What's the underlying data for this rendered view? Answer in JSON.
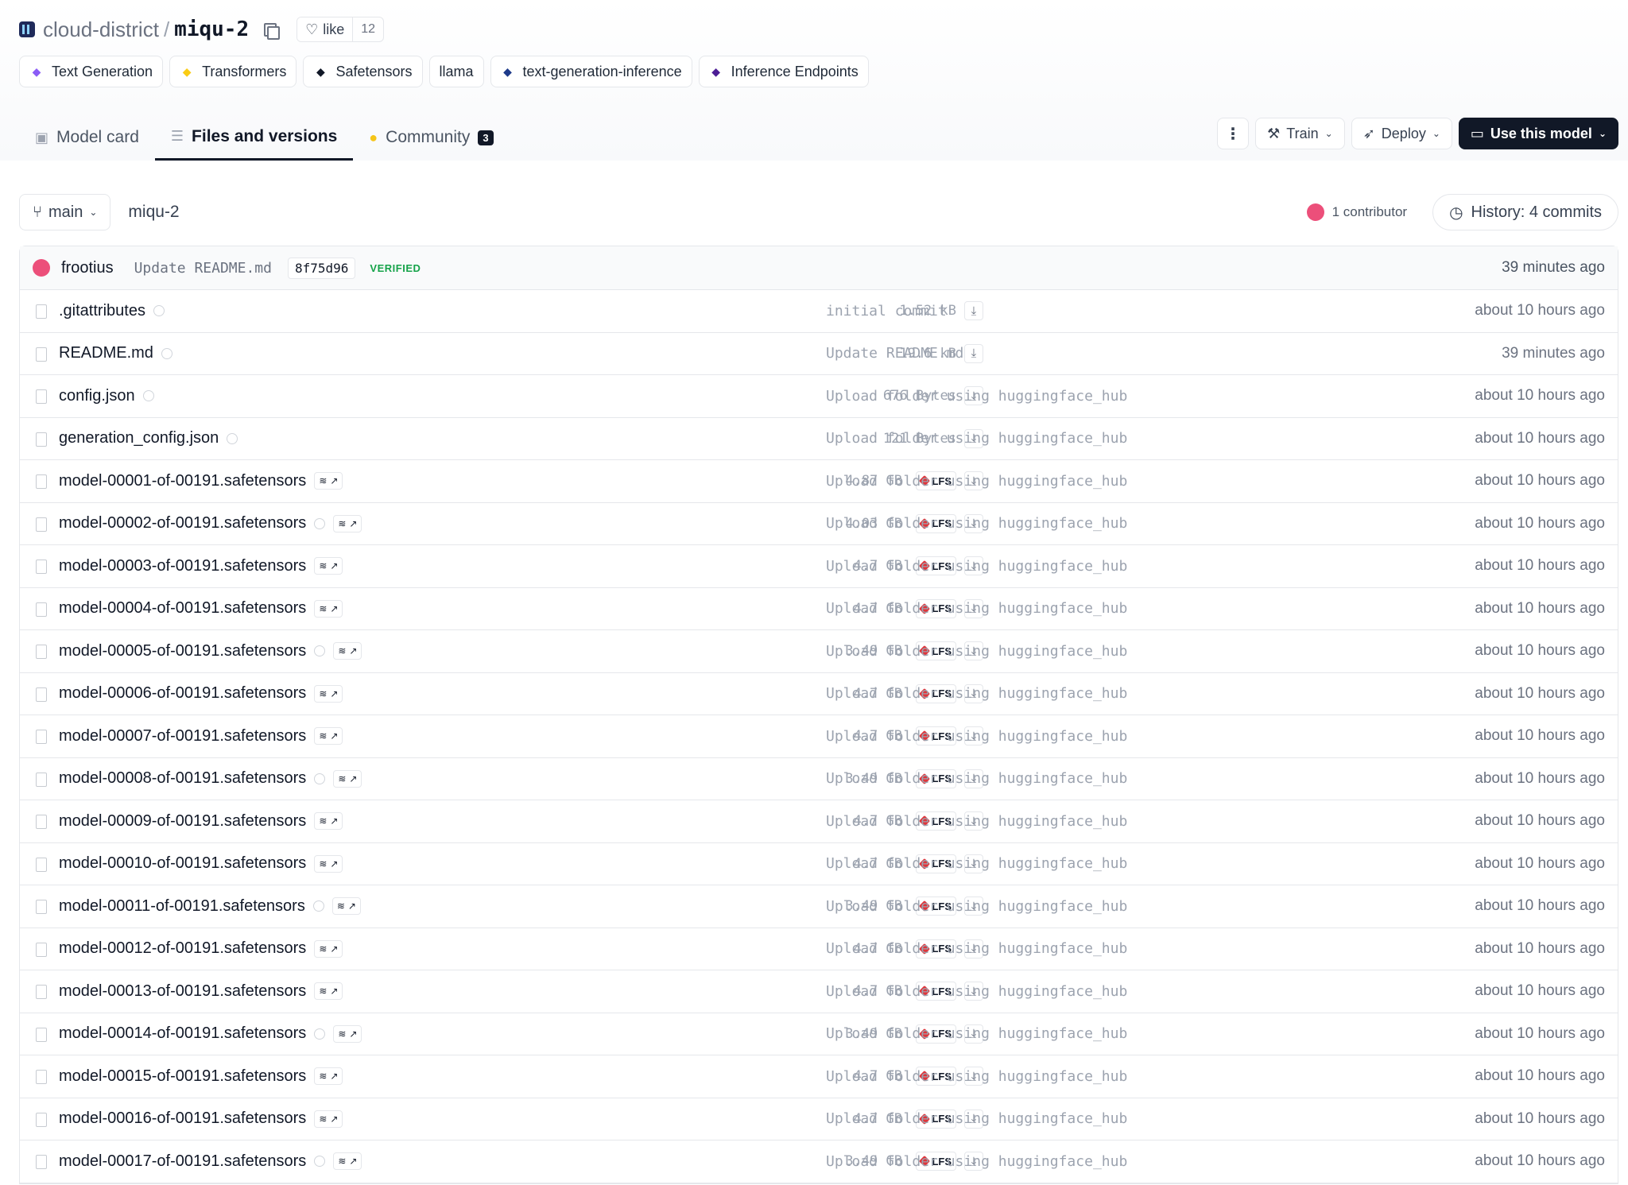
{
  "header": {
    "org": "cloud-district",
    "separator": "/",
    "repo": "miqu-2",
    "like_label": "like",
    "like_count": "12"
  },
  "tags": [
    {
      "label": "Text Generation",
      "icon": "text-generation-icon",
      "color": "#8b5cf6"
    },
    {
      "label": "Transformers",
      "icon": "hugging-face-icon",
      "color": "#facc15"
    },
    {
      "label": "Safetensors",
      "icon": "safetensors-icon",
      "color": "#111827"
    },
    {
      "label": "llama",
      "icon": "",
      "color": ""
    },
    {
      "label": "text-generation-inference",
      "icon": "tgi-icon",
      "color": "#1e3a8a"
    },
    {
      "label": "Inference Endpoints",
      "icon": "inference-endpoints-icon",
      "color": "#4c1d95"
    }
  ],
  "tabs": [
    {
      "label": "Model card",
      "icon": "model-card-icon",
      "active": false
    },
    {
      "label": "Files and versions",
      "icon": "files-icon",
      "active": true
    },
    {
      "label": "Community",
      "icon": "community-icon",
      "active": false,
      "badge": "3"
    }
  ],
  "actions": {
    "train": "Train",
    "deploy": "Deploy",
    "use_model": "Use this model"
  },
  "branch": {
    "name": "main",
    "path": "miqu-2",
    "contributors": "1 contributor",
    "history": "History: 4 commits"
  },
  "last_commit": {
    "author": "frootius",
    "message": "Update README.md",
    "hash": "8f75d96",
    "verified": "VERIFIED",
    "time": "39 minutes ago"
  },
  "files": [
    {
      "name": ".gitattributes",
      "size": "1.52 kB",
      "lfs": false,
      "st": false,
      "st_check": false,
      "message": "initial commit",
      "time": "about 10 hours ago"
    },
    {
      "name": "README.md",
      "size": "19.6 kB",
      "lfs": false,
      "st": false,
      "st_check": false,
      "message": "Update README.md",
      "time": "39 minutes ago"
    },
    {
      "name": "config.json",
      "size": "676 Bytes",
      "lfs": false,
      "st": false,
      "st_check": false,
      "message": "Upload folder using huggingface_hub",
      "time": "about 10 hours ago"
    },
    {
      "name": "generation_config.json",
      "size": "121 Bytes",
      "lfs": false,
      "st": false,
      "st_check": false,
      "message": "Upload folder using huggingface_hub",
      "time": "about 10 hours ago"
    },
    {
      "name": "model-00001-of-00191.safetensors",
      "size": "4.87 GB",
      "lfs": true,
      "st": true,
      "st_check": false,
      "message": "Upload folder using huggingface_hub",
      "time": "about 10 hours ago"
    },
    {
      "name": "model-00002-of-00191.safetensors",
      "size": "4.03 GB",
      "lfs": true,
      "st": true,
      "st_check": true,
      "message": "Upload folder using huggingface_hub",
      "time": "about 10 hours ago"
    },
    {
      "name": "model-00003-of-00191.safetensors",
      "size": "4.7 GB",
      "lfs": true,
      "st": true,
      "st_check": false,
      "message": "Upload folder using huggingface_hub",
      "time": "about 10 hours ago"
    },
    {
      "name": "model-00004-of-00191.safetensors",
      "size": "4.7 GB",
      "lfs": true,
      "st": true,
      "st_check": false,
      "message": "Upload folder using huggingface_hub",
      "time": "about 10 hours ago"
    },
    {
      "name": "model-00005-of-00191.safetensors",
      "size": "3.49 GB",
      "lfs": true,
      "st": true,
      "st_check": true,
      "message": "Upload folder using huggingface_hub",
      "time": "about 10 hours ago"
    },
    {
      "name": "model-00006-of-00191.safetensors",
      "size": "4.7 GB",
      "lfs": true,
      "st": true,
      "st_check": false,
      "message": "Upload folder using huggingface_hub",
      "time": "about 10 hours ago"
    },
    {
      "name": "model-00007-of-00191.safetensors",
      "size": "4.7 GB",
      "lfs": true,
      "st": true,
      "st_check": false,
      "message": "Upload folder using huggingface_hub",
      "time": "about 10 hours ago"
    },
    {
      "name": "model-00008-of-00191.safetensors",
      "size": "3.49 GB",
      "lfs": true,
      "st": true,
      "st_check": true,
      "message": "Upload folder using huggingface_hub",
      "time": "about 10 hours ago"
    },
    {
      "name": "model-00009-of-00191.safetensors",
      "size": "4.7 GB",
      "lfs": true,
      "st": true,
      "st_check": false,
      "message": "Upload folder using huggingface_hub",
      "time": "about 10 hours ago"
    },
    {
      "name": "model-00010-of-00191.safetensors",
      "size": "4.7 GB",
      "lfs": true,
      "st": true,
      "st_check": false,
      "message": "Upload folder using huggingface_hub",
      "time": "about 10 hours ago"
    },
    {
      "name": "model-00011-of-00191.safetensors",
      "size": "3.49 GB",
      "lfs": true,
      "st": true,
      "st_check": true,
      "message": "Upload folder using huggingface_hub",
      "time": "about 10 hours ago"
    },
    {
      "name": "model-00012-of-00191.safetensors",
      "size": "4.7 GB",
      "lfs": true,
      "st": true,
      "st_check": false,
      "message": "Upload folder using huggingface_hub",
      "time": "about 10 hours ago"
    },
    {
      "name": "model-00013-of-00191.safetensors",
      "size": "4.7 GB",
      "lfs": true,
      "st": true,
      "st_check": false,
      "message": "Upload folder using huggingface_hub",
      "time": "about 10 hours ago"
    },
    {
      "name": "model-00014-of-00191.safetensors",
      "size": "3.49 GB",
      "lfs": true,
      "st": true,
      "st_check": true,
      "message": "Upload folder using huggingface_hub",
      "time": "about 10 hours ago"
    },
    {
      "name": "model-00015-of-00191.safetensors",
      "size": "4.7 GB",
      "lfs": true,
      "st": true,
      "st_check": false,
      "message": "Upload folder using huggingface_hub",
      "time": "about 10 hours ago"
    },
    {
      "name": "model-00016-of-00191.safetensors",
      "size": "4.7 GB",
      "lfs": true,
      "st": true,
      "st_check": false,
      "message": "Upload folder using huggingface_hub",
      "time": "about 10 hours ago"
    },
    {
      "name": "model-00017-of-00191.safetensors",
      "size": "3.49 GB",
      "lfs": true,
      "st": true,
      "st_check": true,
      "message": "Upload folder using huggingface_hub",
      "time": "about 10 hours ago"
    }
  ],
  "lfs_label": "LFS",
  "colors": {
    "contributor_avatar": "#ec4f7a",
    "verified": "#16a34a",
    "primary_button": "#111827"
  }
}
